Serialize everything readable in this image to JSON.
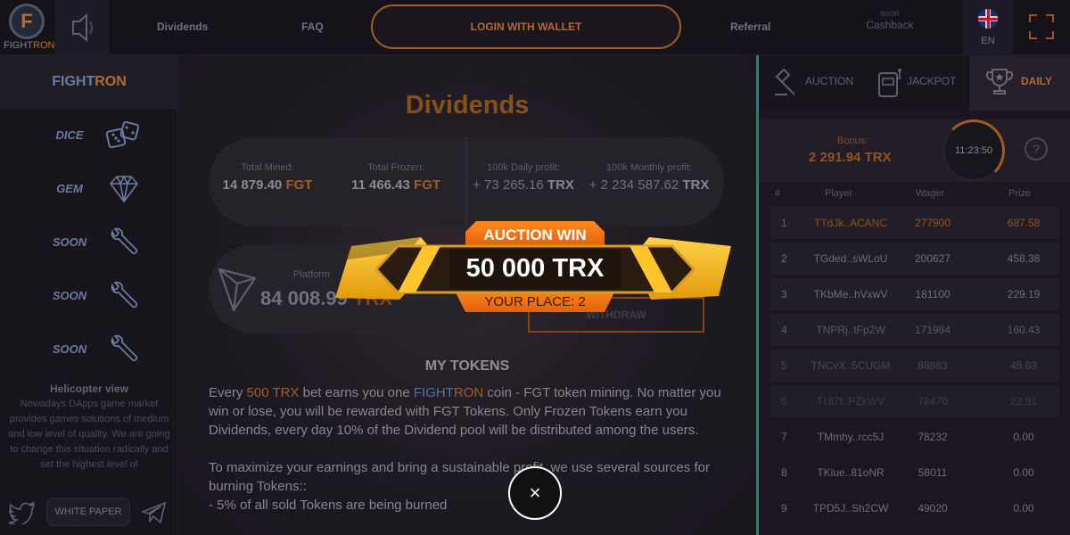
{
  "header": {
    "logo_text_a": "FIGHT",
    "logo_text_b": "RON",
    "logo_mark": "F",
    "nav": {
      "dividends": "Dividends",
      "faq": "FAQ",
      "referral": "Referral"
    },
    "login_label": "LOGIN WITH WALLET",
    "cashback_soon": "soon",
    "cashback_label": "Cashback",
    "language": "EN"
  },
  "sidebar": {
    "title_a": "FIGHT",
    "title_b": "RON",
    "games": [
      {
        "label": "DICE",
        "icon": "dice-icon"
      },
      {
        "label": "GEM",
        "icon": "gem-icon"
      },
      {
        "label": "SOON",
        "icon": "wrench-icon"
      },
      {
        "label": "SOON",
        "icon": "wrench-icon"
      },
      {
        "label": "SOON",
        "icon": "wrench-icon"
      }
    ],
    "heli_title": "Helicopter view",
    "heli_text": "Nowadays DApps game market provides games solutions of medium and low level of quality. We are going to change this situation radically and set the highest level of",
    "white_paper": "WHITE PAPER"
  },
  "main": {
    "title": "Dividends",
    "stats": [
      {
        "label": "Total Mined:",
        "value": "14 879.40",
        "unit": "FGT"
      },
      {
        "label": "Total Frozen:",
        "value": "11 466.43",
        "unit": "FGT"
      },
      {
        "label": "100k Daily profit:",
        "value": "+ 73 265.16",
        "unit": "TRX"
      },
      {
        "label": "100k Monthly profit:",
        "value": "+ 2 234 587.62",
        "unit": "TRX"
      }
    ],
    "platform_label": "Platform",
    "platform_value": "84 008.99",
    "platform_unit": "TRX",
    "withdraw": "WITHDRAW",
    "my_tokens": "MY TOKENS",
    "p1_a": "Every ",
    "p1_amount": "500 TRX",
    "p1_b": " bet earns you one ",
    "p1_brand_a": "FIGHT",
    "p1_brand_b": "RON",
    "p1_c": " coin - FGT token mining. No matter you win or lose, you will be rewarded with FGT Tokens. Only Frozen Tokens earn you Dividends, every day 10% of the Dividend pool will be distributed among the users.",
    "p2": "To maximize your earnings and bring a sustainable profit, we use several sources for burning Tokens::",
    "p3": "- 5% of all sold Tokens are being burned"
  },
  "right": {
    "tabs": {
      "auction": "AUCTION",
      "jackpot": "JACKPOT",
      "daily": "DAILY"
    },
    "bonus_label": "Bonus:",
    "bonus_value": "2 291.94 TRX",
    "timer": "11:23:50",
    "help": "?",
    "head": {
      "num": "#",
      "player": "Player",
      "wager": "Wager",
      "prize": "Prize"
    },
    "rows": [
      {
        "num": "1",
        "player": "TTdJk..ACANC",
        "wager": "277900",
        "prize": "687.58"
      },
      {
        "num": "2",
        "player": "TGded..sWLoU",
        "wager": "200627",
        "prize": "458.38"
      },
      {
        "num": "3",
        "player": "TKbMe..hVxwV",
        "wager": "181100",
        "prize": "229.19"
      },
      {
        "num": "4",
        "player": "TNPRj..tFp2W",
        "wager": "171984",
        "prize": "160.43"
      },
      {
        "num": "5",
        "player": "TNCvX..5CUGM",
        "wager": "88883",
        "prize": "45.83"
      },
      {
        "num": "6",
        "player": "TUi7f..PZkWV",
        "wager": "78470",
        "prize": "22.91"
      },
      {
        "num": "7",
        "player": "TMmhy..rcc5J",
        "wager": "78232",
        "prize": "0.00"
      },
      {
        "num": "8",
        "player": "TKiue..81oNR",
        "wager": "58011",
        "prize": "0.00"
      },
      {
        "num": "9",
        "player": "TPD5J..Sh2CW",
        "wager": "49020",
        "prize": "0.00"
      }
    ]
  },
  "overlay": {
    "banner_title": "AUCTION WIN",
    "banner_amount": "50 000 TRX",
    "banner_place": "YOUR PLACE: 2",
    "close": "×"
  },
  "colors": {
    "accent": "#d9833a",
    "brand_blue": "#7a98c8",
    "teal": "#4a8f8c",
    "banner_gold": "#f0b11d"
  }
}
